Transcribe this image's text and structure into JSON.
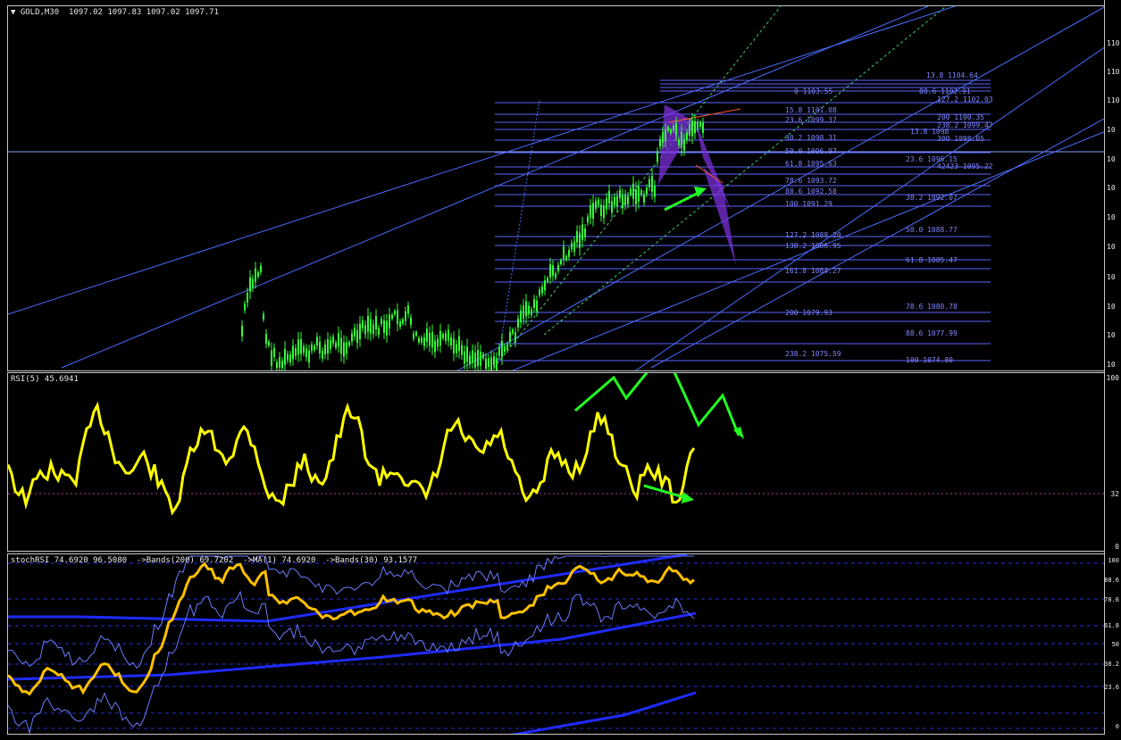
{
  "main": {
    "title_prefix": "▼",
    "title": "GOLD,M30  1097.02 1097.83 1097.02 1097.71"
  },
  "rsi": {
    "title": "RSI(5) 45.6941",
    "ticks": [
      "100",
      "32",
      "0"
    ]
  },
  "stoch": {
    "title": "stochRSI 74.6920 96.5080  ->Bands(200) 69.7202  ->MA(1) 74.6920  ->Bands(30) 93.1577",
    "ticks": [
      "100",
      "88.6",
      "78.6",
      "61.8",
      "50",
      "38.2",
      "23.6",
      "0"
    ]
  },
  "fib_labels": [
    "13.8 1104.64",
    "0 1103.55",
    "88.6 1102.91",
    "127.2 1102.03",
    "15.8 1101.08",
    "200 1100.35",
    "23.6 1099.37",
    "238.2 1099.47",
    "13.8 1098",
    "30.2 1098.31",
    "300 1098.05",
    "50.0 1096.97",
    "23.6 1096.15",
    "61.8 1095.63",
    "42423 1095.22",
    "78.6 1093.72",
    "88.6 1092.58",
    "38.2 1092.07",
    "100 1091.29",
    "50.0 1088.77",
    "127.2 1088.20",
    "138.2 1086.95",
    "61.8 1085.47",
    "161.8 1084.27",
    "78.6 1080.78",
    "200 1079.93",
    "88.6 1077.99",
    "238.2 1075.59",
    "100 1074.80"
  ],
  "price_axis": [
    "110",
    "110",
    "110",
    "10",
    "10",
    "10",
    "10",
    "10",
    "10",
    "10",
    "10",
    "10"
  ],
  "colors": {
    "background": "#000000",
    "candles": "#33ff33",
    "fib_lines": "#5b63ff",
    "channel_lines": "#4a6cff",
    "rsi_line": "#ffff00",
    "stoch_line": "#ffc000",
    "arrows": "#22ff22",
    "pattern": "#7a2fd8"
  }
}
